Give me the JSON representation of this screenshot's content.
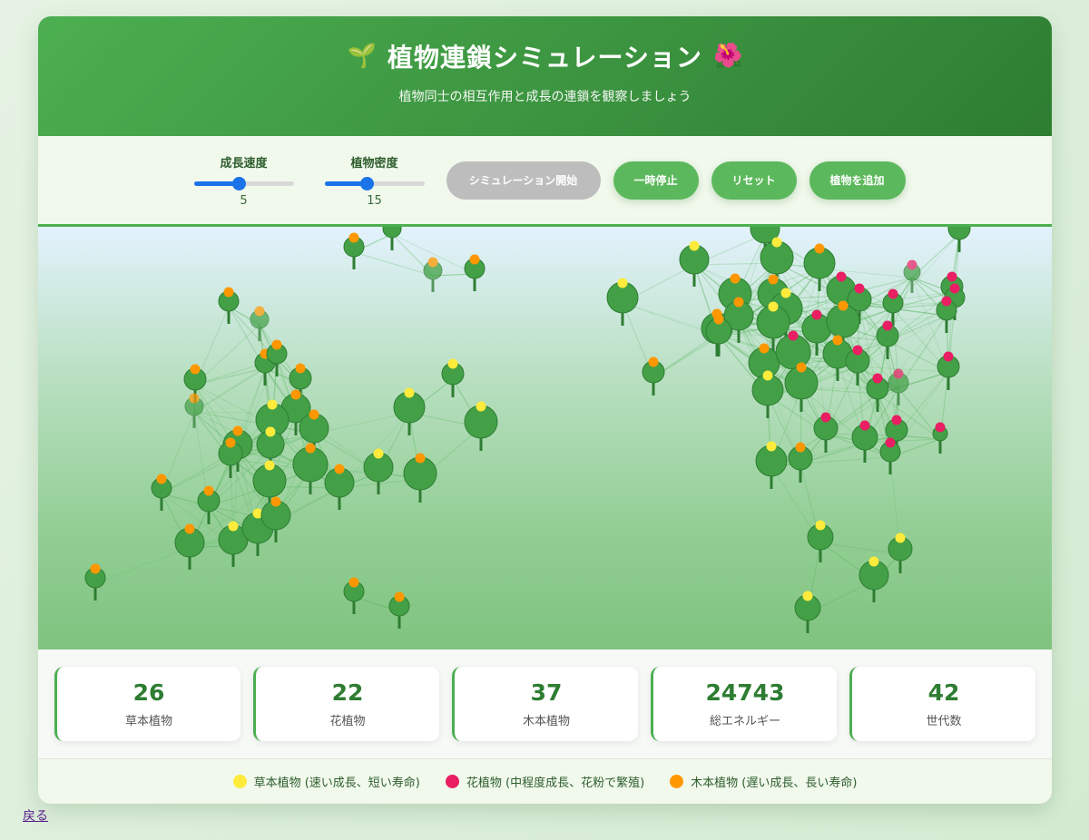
{
  "header": {
    "icon_left": "🌱",
    "title": "植物連鎖シミュレーション",
    "icon_right": "🌺",
    "subtitle": "植物同士の相互作用と成長の連鎖を観察しましょう"
  },
  "controls": {
    "growth_speed": {
      "label": "成長速度",
      "value": "5",
      "min": 1,
      "max": 10,
      "level": 0.45
    },
    "plant_density": {
      "label": "植物密度",
      "value": "15",
      "min": 5,
      "max": 50,
      "level": 0.42
    },
    "buttons": {
      "start": "シミュレーション開始",
      "pause": "一時停止",
      "reset": "リセット",
      "add_plant": "植物を追加"
    }
  },
  "colors": {
    "herb": "#ffeb3b",
    "flower": "#e91e63",
    "tree": "#ff9800",
    "leaf": "#43a047",
    "stem": "#2e7d32",
    "link": "#4caf50"
  },
  "stats": [
    {
      "value": "26",
      "label": "草本植物"
    },
    {
      "value": "22",
      "label": "花植物"
    },
    {
      "value": "37",
      "label": "木本植物"
    },
    {
      "value": "24743",
      "label": "総エネルギー"
    },
    {
      "value": "42",
      "label": "世代数"
    }
  ],
  "legend": [
    {
      "type": "herb",
      "label": "草本植物 (速い成長、短い寿命)"
    },
    {
      "type": "flower",
      "label": "花植物 (中程度成長、花粉で繁殖)"
    },
    {
      "type": "tree",
      "label": "木本植物 (遅い成長、長い寿命)"
    }
  ],
  "back_link": "戻る"
}
